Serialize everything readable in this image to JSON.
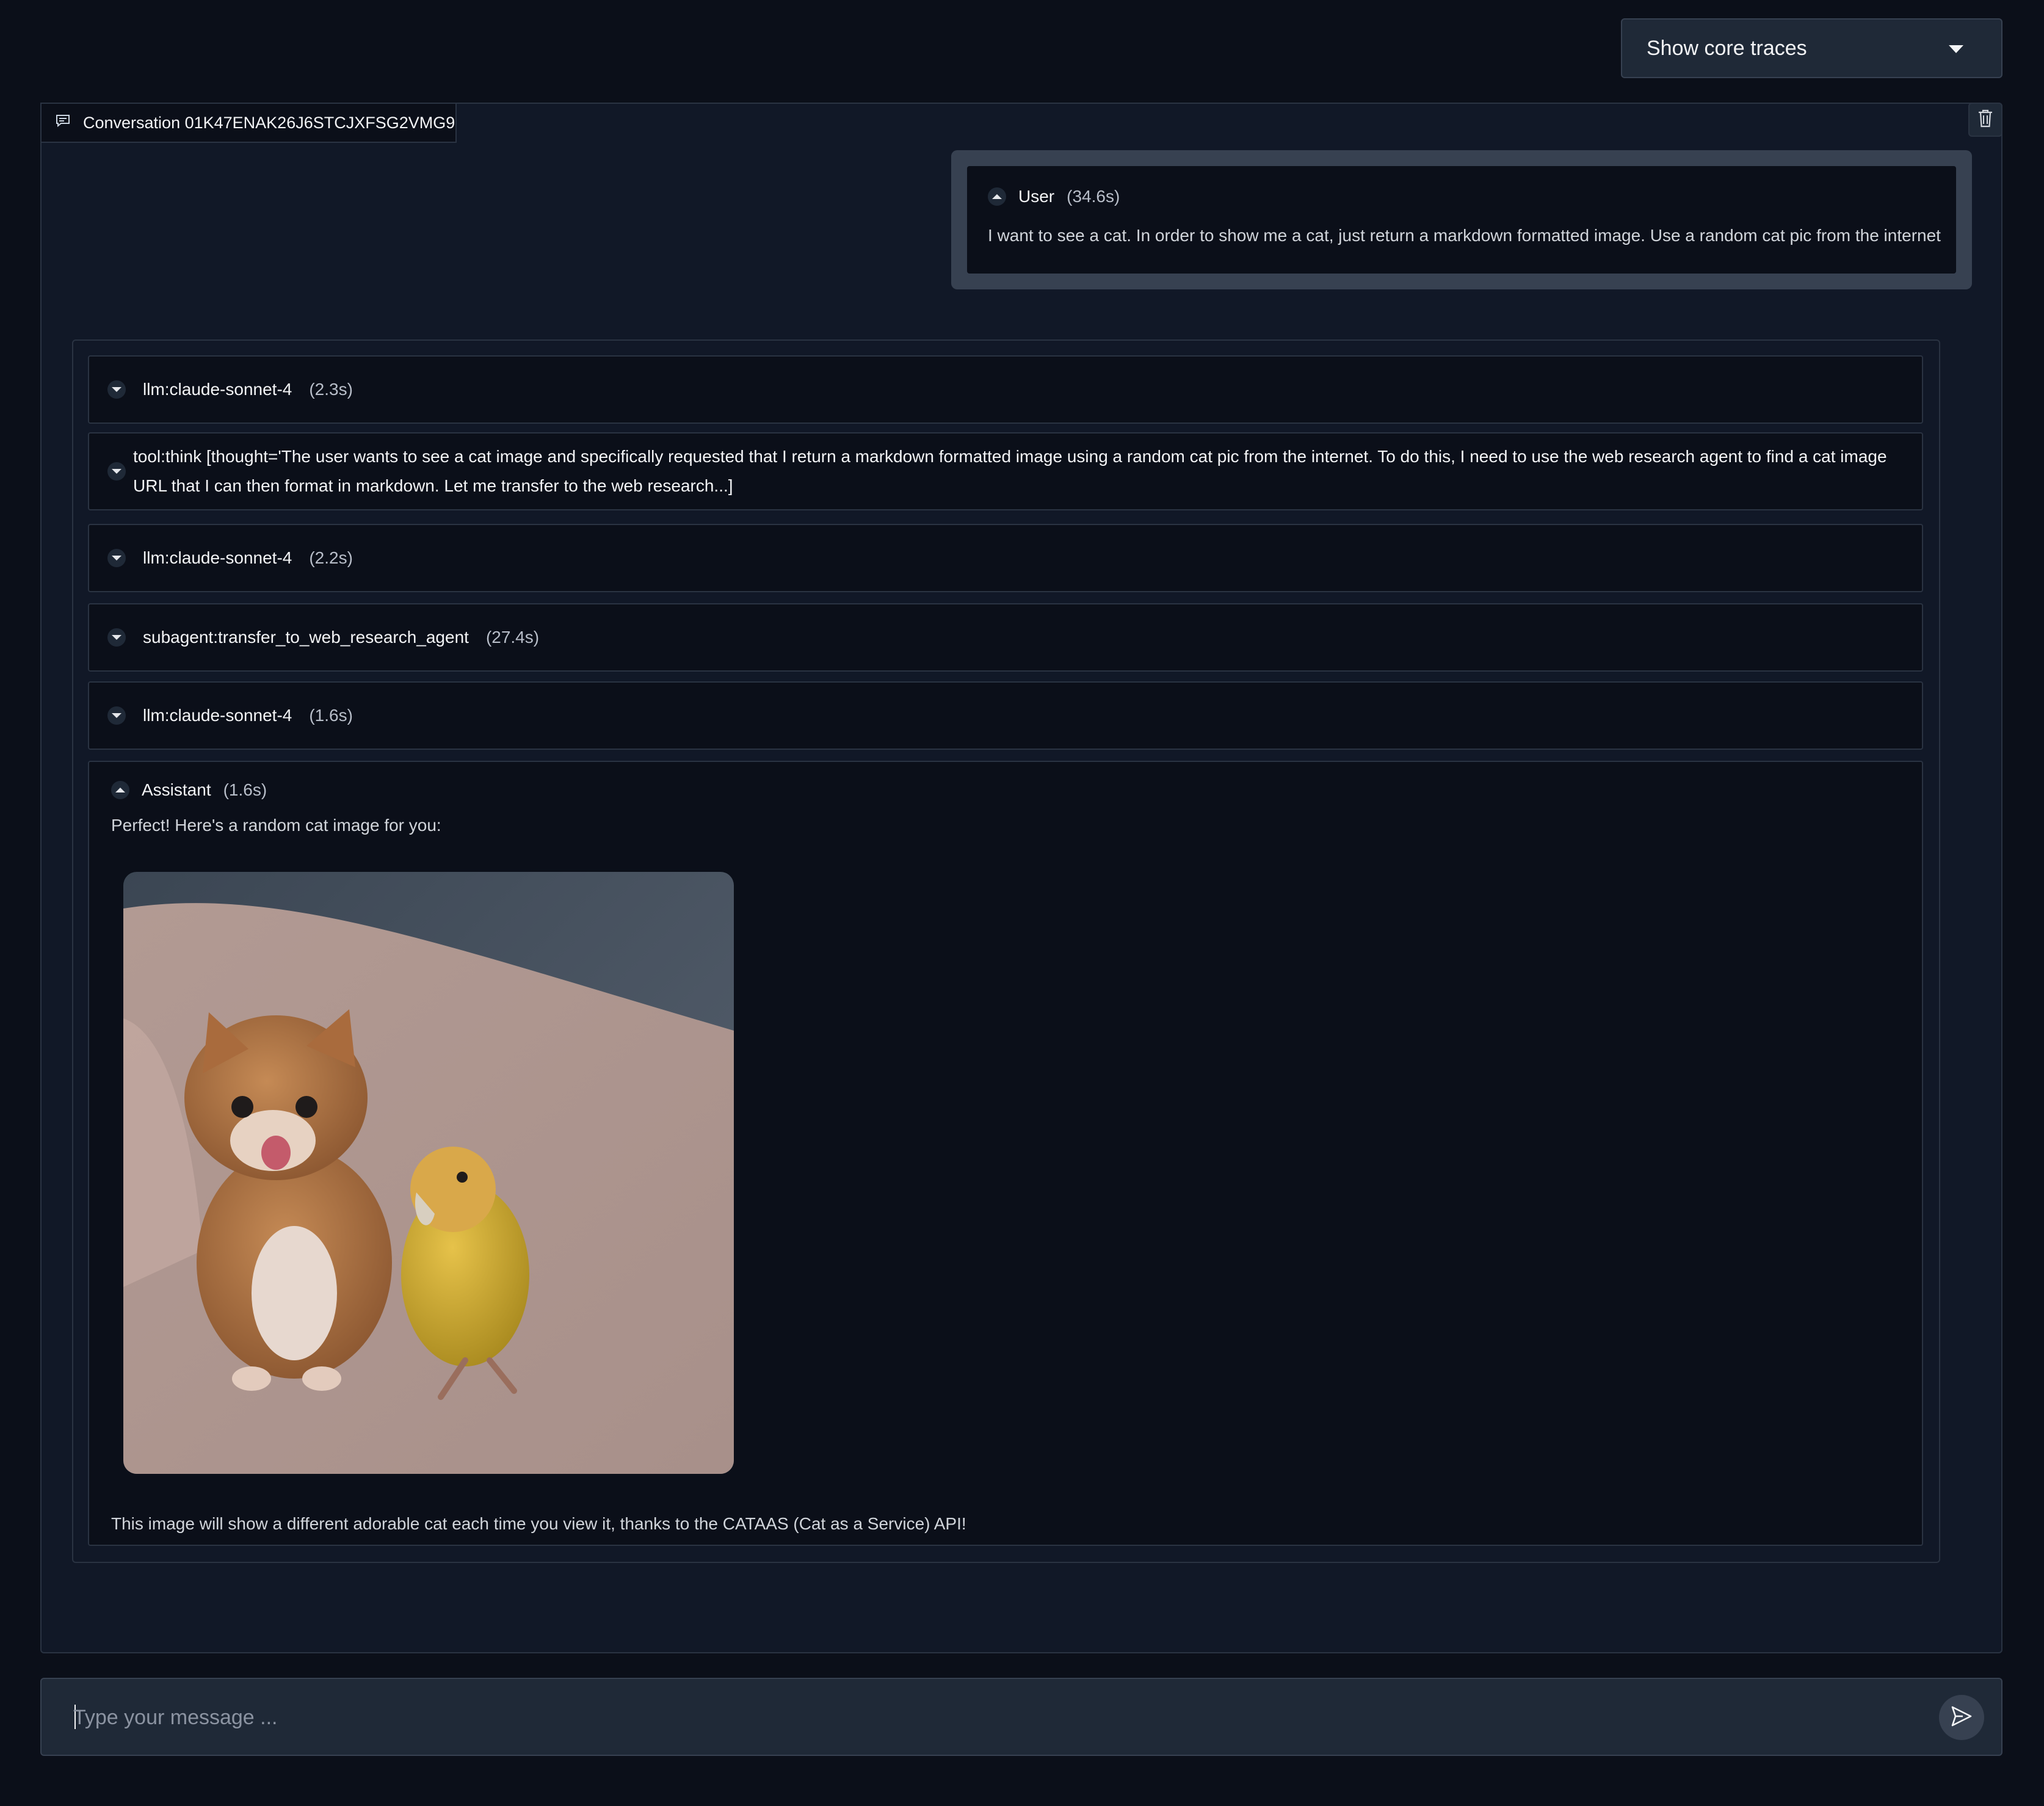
{
  "toolbar": {
    "trace_filter": "Show core traces"
  },
  "conversation": {
    "tab_label": "Conversation 01K47ENAK26J6STCJXFSG2VMG9",
    "user": {
      "role": "User",
      "duration": "(34.6s)",
      "message": "I want to see a cat. In order to show me a cat, just return a markdown formatted image. Use a random cat pic from the internet"
    },
    "traces": [
      {
        "label": "llm:claude-sonnet-4",
        "duration": "(2.3s)"
      },
      {
        "label": "tool:think [thought='The user wants to see a cat image and specifically requested that I return a markdown formatted image using a random cat pic from the internet. To do this, I need to use the web research agent to find a cat image URL that I can then format in markdown. Let me transfer to the web research...]"
      },
      {
        "label": "llm:claude-sonnet-4",
        "duration": "(2.2s)"
      },
      {
        "label": "subagent:transfer_to_web_research_agent",
        "duration": "(27.4s)"
      },
      {
        "label": "llm:claude-sonnet-4",
        "duration": "(1.6s)"
      }
    ],
    "assistant": {
      "role": "Assistant",
      "duration": "(1.6s)",
      "intro": "Perfect! Here's a random cat image for you:",
      "outro": "This image will show a different adorable cat each time you view it, thanks to the CATAAS (Cat as a Service) API!"
    }
  },
  "composer": {
    "placeholder": "Type your message ..."
  },
  "icons": {
    "chat": "chat-icon",
    "trash": "trash-icon",
    "caret": "chevron-down-icon",
    "collapse": "chevron-up-icon",
    "expand": "chevron-down-icon",
    "send": "send-icon"
  }
}
